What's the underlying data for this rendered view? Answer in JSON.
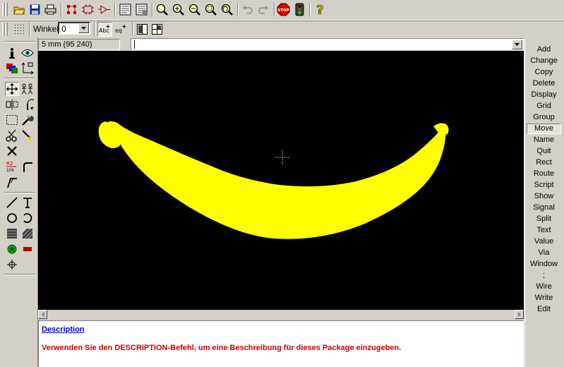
{
  "toolbar": {
    "icons": [
      "open-icon",
      "save-icon",
      "print-icon",
      "board-icon",
      "schematic-icon",
      "symbol-icon",
      "script-icon",
      "ulp-icon",
      "zoom-fit-icon",
      "zoom-in-icon",
      "zoom-out-icon",
      "zoom-select-icon",
      "redraw-icon",
      "undo-icon",
      "redo-icon",
      "stop-icon",
      "go-icon",
      "help-icon"
    ]
  },
  "params": {
    "angle_label": "Winkel:",
    "angle_value": "0"
  },
  "status": {
    "coordinates": "5 mm (95 240)",
    "command_value": ""
  },
  "commands": [
    "Add",
    "Change",
    "Copy",
    "Delete",
    "Display",
    "Grid",
    "Group",
    "Move",
    "Name",
    "Quit",
    "Rect",
    "Route",
    "Script",
    "Show",
    "Signal",
    "Split",
    "Text",
    "Value",
    "Via",
    "Window",
    ";",
    "Wire",
    "Write",
    "Edit"
  ],
  "active_command": "Move",
  "canvas": {
    "background": "#000000",
    "shape_color": "#ffff00"
  },
  "description": {
    "title": "Description",
    "text": "Verwenden Sie den DESCRIPTION-Befehl, um eine Beschreibung für dieses Package einzugeben."
  },
  "colors": {
    "title_link": "#0000cc",
    "hint_text": "#cc0000"
  }
}
